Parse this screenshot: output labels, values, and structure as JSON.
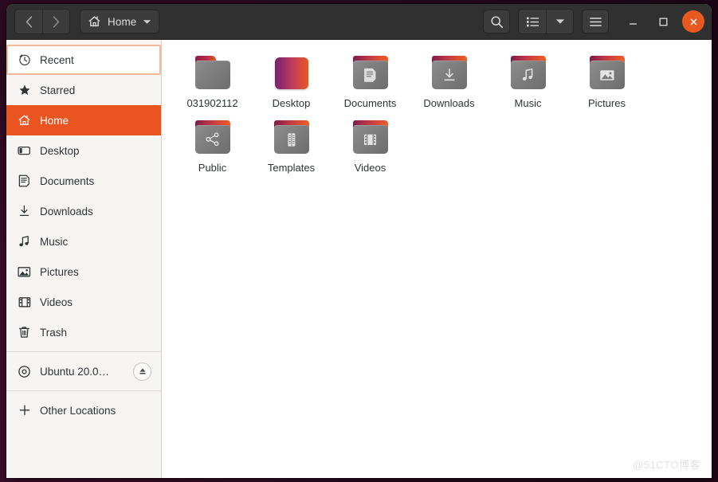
{
  "window": {
    "title": "Home",
    "close_label": "×",
    "maximize_label": "□",
    "minimize_label": "—"
  },
  "header": {
    "back_name": "back",
    "forward_name": "forward",
    "path_label": "Home",
    "path_icon": "home-icon",
    "search_icon": "search-icon",
    "view_list_icon": "list-view-icon",
    "view_dropdown_icon": "chevron-down-icon",
    "menu_icon": "hamburger-menu-icon"
  },
  "sidebar": {
    "items": [
      {
        "label": "Recent",
        "icon": "clock-icon",
        "state": "focused",
        "key": "recent"
      },
      {
        "label": "Starred",
        "icon": "star-icon",
        "state": "normal",
        "key": "starred"
      },
      {
        "label": "Home",
        "icon": "home-icon",
        "state": "selected",
        "key": "home"
      },
      {
        "label": "Desktop",
        "icon": "desktop-icon",
        "state": "normal",
        "key": "desktop"
      },
      {
        "label": "Documents",
        "icon": "document-icon",
        "state": "normal",
        "key": "documents"
      },
      {
        "label": "Downloads",
        "icon": "download-icon",
        "state": "normal",
        "key": "downloads"
      },
      {
        "label": "Music",
        "icon": "music-icon",
        "state": "normal",
        "key": "music"
      },
      {
        "label": "Pictures",
        "icon": "image-icon",
        "state": "normal",
        "key": "pictures"
      },
      {
        "label": "Videos",
        "icon": "film-icon",
        "state": "normal",
        "key": "videos"
      },
      {
        "label": "Trash",
        "icon": "trash-icon",
        "state": "normal",
        "key": "trash"
      }
    ],
    "devices": [
      {
        "label": "Ubuntu 20.0…",
        "icon": "disc-icon",
        "eject_icon": "eject-icon",
        "key": "ubuntu-disc"
      }
    ],
    "other_locations": {
      "label": "Other Locations",
      "icon": "plus-icon",
      "key": "other-locations"
    }
  },
  "main": {
    "files": [
      {
        "name": "031902112",
        "icon": "folder-plain-icon",
        "emblem": "none"
      },
      {
        "name": "Desktop",
        "icon": "wallpaper-thumbnail",
        "emblem": "none"
      },
      {
        "name": "Documents",
        "icon": "folder-documents-icon",
        "emblem": "document"
      },
      {
        "name": "Downloads",
        "icon": "folder-downloads-icon",
        "emblem": "download"
      },
      {
        "name": "Music",
        "icon": "folder-music-icon",
        "emblem": "music"
      },
      {
        "name": "Pictures",
        "icon": "folder-pictures-icon",
        "emblem": "image"
      },
      {
        "name": "Public",
        "icon": "folder-public-icon",
        "emblem": "share"
      },
      {
        "name": "Templates",
        "icon": "folder-templates-icon",
        "emblem": "template"
      },
      {
        "name": "Videos",
        "icon": "folder-videos-icon",
        "emblem": "film"
      }
    ]
  },
  "watermark": {
    "text": "@51CTO博客"
  },
  "colors": {
    "accent_orange": "#e95420",
    "headerbar_dark": "#303030",
    "sidebar_gray": "#f6f5f4",
    "main_white": "#ffffff",
    "focus_outline": "#f5b99a",
    "desktop_purple": "#2c0a1e"
  }
}
